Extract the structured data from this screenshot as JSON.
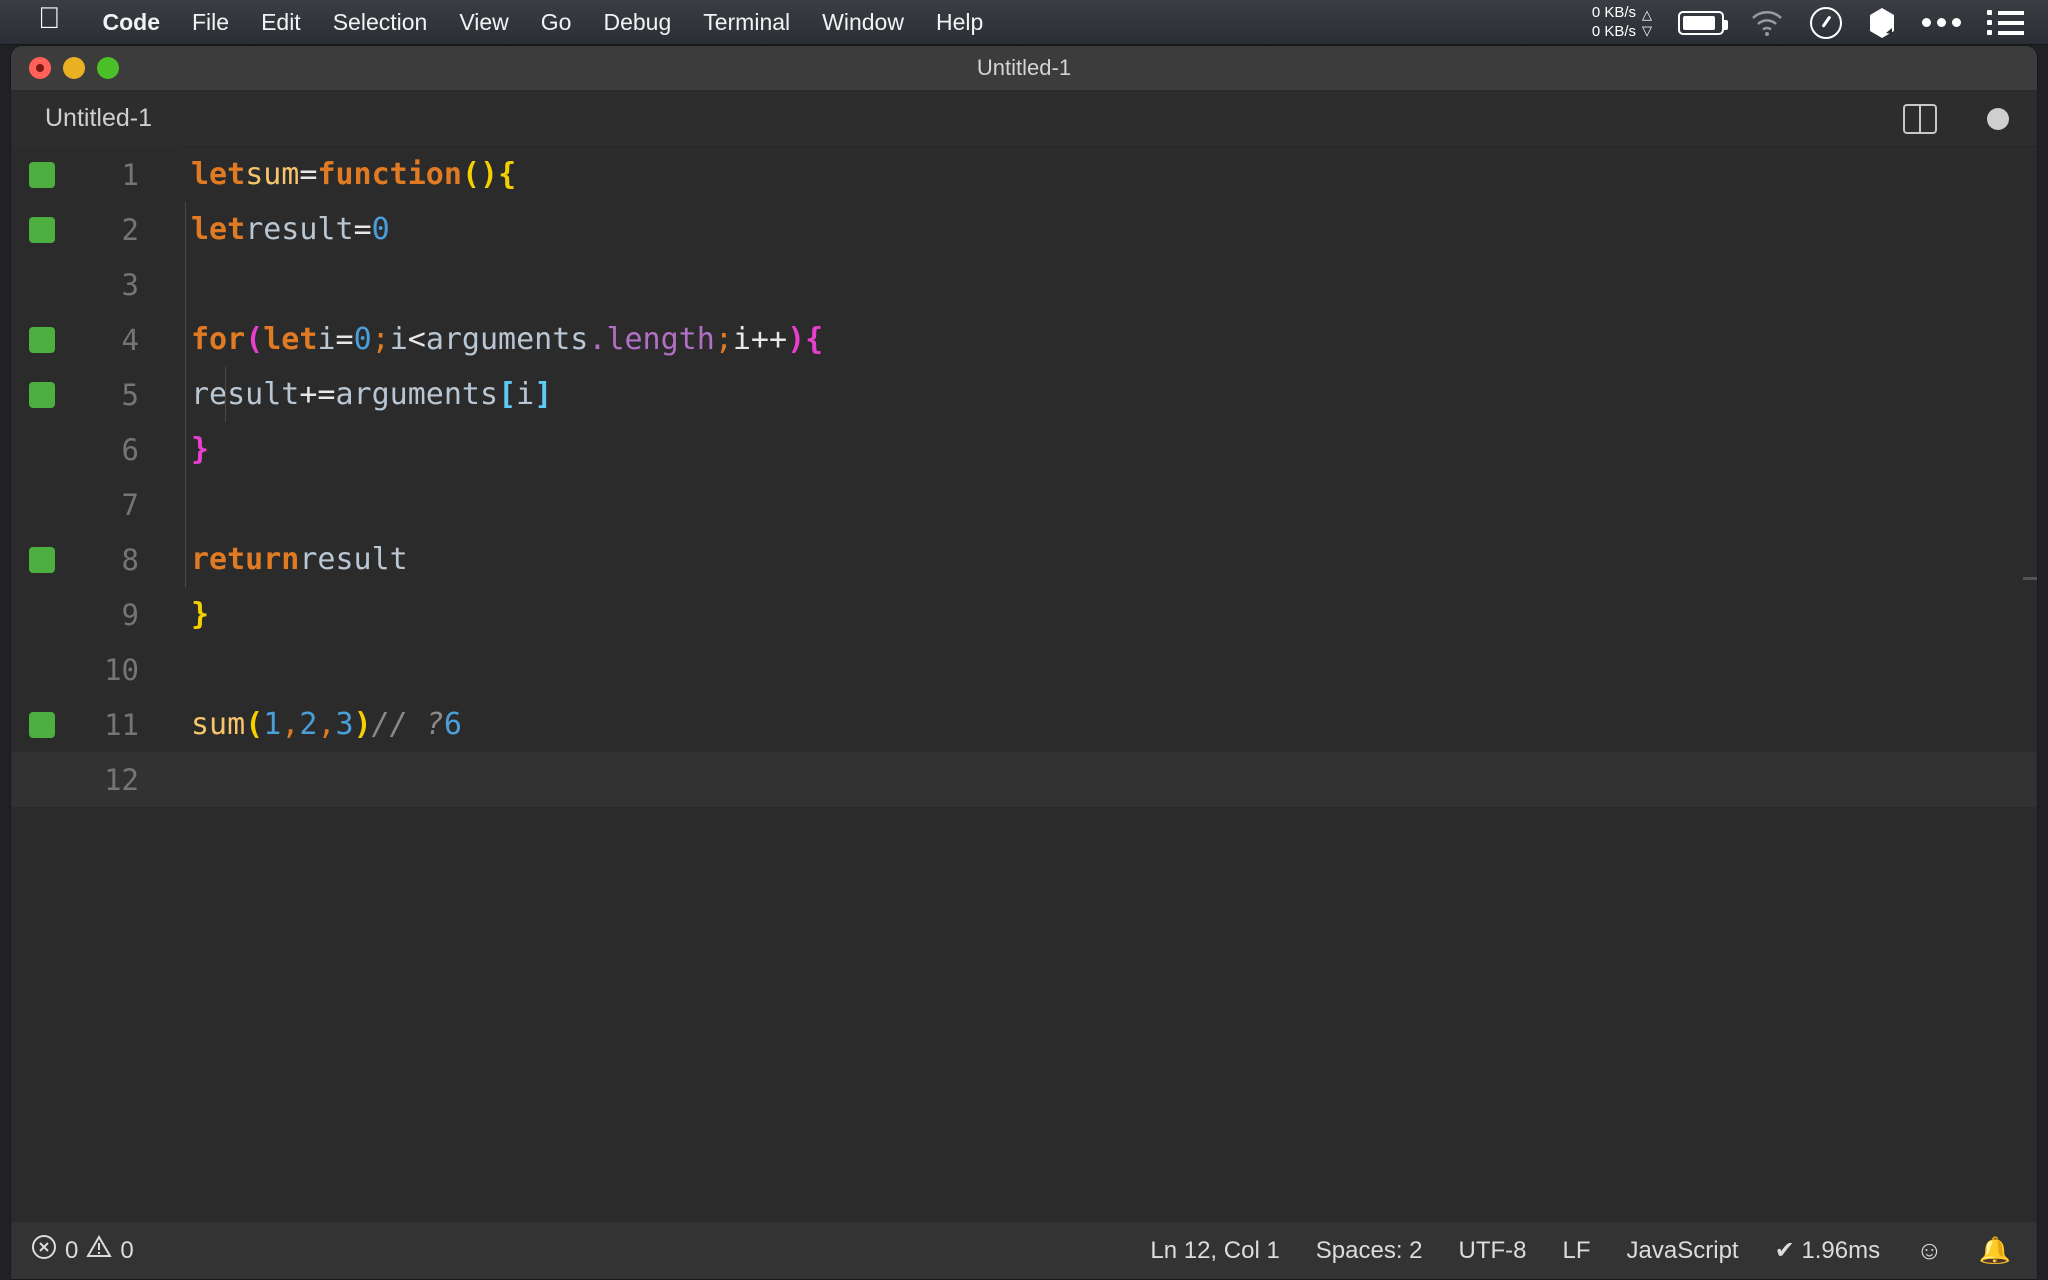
{
  "menubar": {
    "apple_logo": "apple-icon",
    "items": [
      "Code",
      "File",
      "Edit",
      "Selection",
      "View",
      "Go",
      "Debug",
      "Terminal",
      "Window",
      "Help"
    ],
    "status": {
      "net_up": "0 KB/s",
      "net_down": "0 KB/s",
      "icons": [
        "battery-icon",
        "wifi-icon",
        "control-center-icon",
        "cube-icon",
        "more-dots-icon",
        "list-icon"
      ]
    }
  },
  "window": {
    "title": "Untitled-1",
    "traffic_lights": [
      "close-button",
      "minimize-button",
      "maximize-button"
    ]
  },
  "tabbar": {
    "tab_label": "Untitled-1",
    "actions": [
      "split-editor-icon",
      "unsaved-indicator"
    ]
  },
  "editor": {
    "language": "JavaScript",
    "lines": [
      {
        "n": "1",
        "mark": true,
        "indent": 0
      },
      {
        "n": "2",
        "mark": true,
        "indent": 1
      },
      {
        "n": "3",
        "mark": false,
        "indent": 1
      },
      {
        "n": "4",
        "mark": true,
        "indent": 1
      },
      {
        "n": "5",
        "mark": true,
        "indent": 2
      },
      {
        "n": "6",
        "mark": false,
        "indent": 1
      },
      {
        "n": "7",
        "mark": false,
        "indent": 1
      },
      {
        "n": "8",
        "mark": true,
        "indent": 1
      },
      {
        "n": "9",
        "mark": false,
        "indent": 0
      },
      {
        "n": "10",
        "mark": false,
        "indent": 0
      },
      {
        "n": "11",
        "mark": true,
        "indent": 0
      },
      {
        "n": "12",
        "mark": false,
        "indent": 0
      }
    ],
    "code_text": {
      "l1": "let sum = function() {",
      "l2": "  let result = 0",
      "l3": "",
      "l4": "  for(let i = 0; i < arguments.length; i++) {",
      "l5": "    result += arguments[i]",
      "l6": "  }",
      "l7": "",
      "l8": "  return result",
      "l9": "}",
      "l10": "",
      "l11": "sum(1, 2, 3) // ?  6",
      "l12": ""
    },
    "tokens": {
      "let": "let",
      "sum_name": "sum",
      "eq": "=",
      "function": "function",
      "result": "result",
      "zero": "0",
      "for": "for",
      "i": "i",
      "lt": "<",
      "arguments": "arguments",
      "dot": ".",
      "length": "length",
      "semi": ";",
      "incr": "i++",
      "plus_eq": "+=",
      "return": "return",
      "comment": "// ?",
      "answer": "6",
      "n1": "1",
      "n2": "2",
      "n3": "3",
      "comma": ",",
      "paren_open": "(",
      "paren_close": ")",
      "brace_open": "{",
      "brace_close": "}",
      "bracket_open": "[",
      "bracket_close": "]"
    },
    "colors": {
      "background": "#2b2b2b",
      "keyword": "#e07b24",
      "function_name": "#f7c46c",
      "variable": "#b9c6d3",
      "number": "#4a9fd8",
      "property": "#b26fc5",
      "comment": "#8a8a8a",
      "bracket_yellow": "#f5d000",
      "bracket_magenta": "#e83fd0",
      "bracket_cyan": "#5fc8f5",
      "run_marker": "#4caf3f",
      "line_number": "#757575"
    }
  },
  "statusbar": {
    "errors": "0",
    "warnings": "0",
    "cursor": "Ln 12, Col 1",
    "spaces": "Spaces: 2",
    "encoding": "UTF-8",
    "eol": "LF",
    "language": "JavaScript",
    "timing": "✔ 1.96ms",
    "feedback": "smiley-icon",
    "notifications": "bell-icon"
  }
}
